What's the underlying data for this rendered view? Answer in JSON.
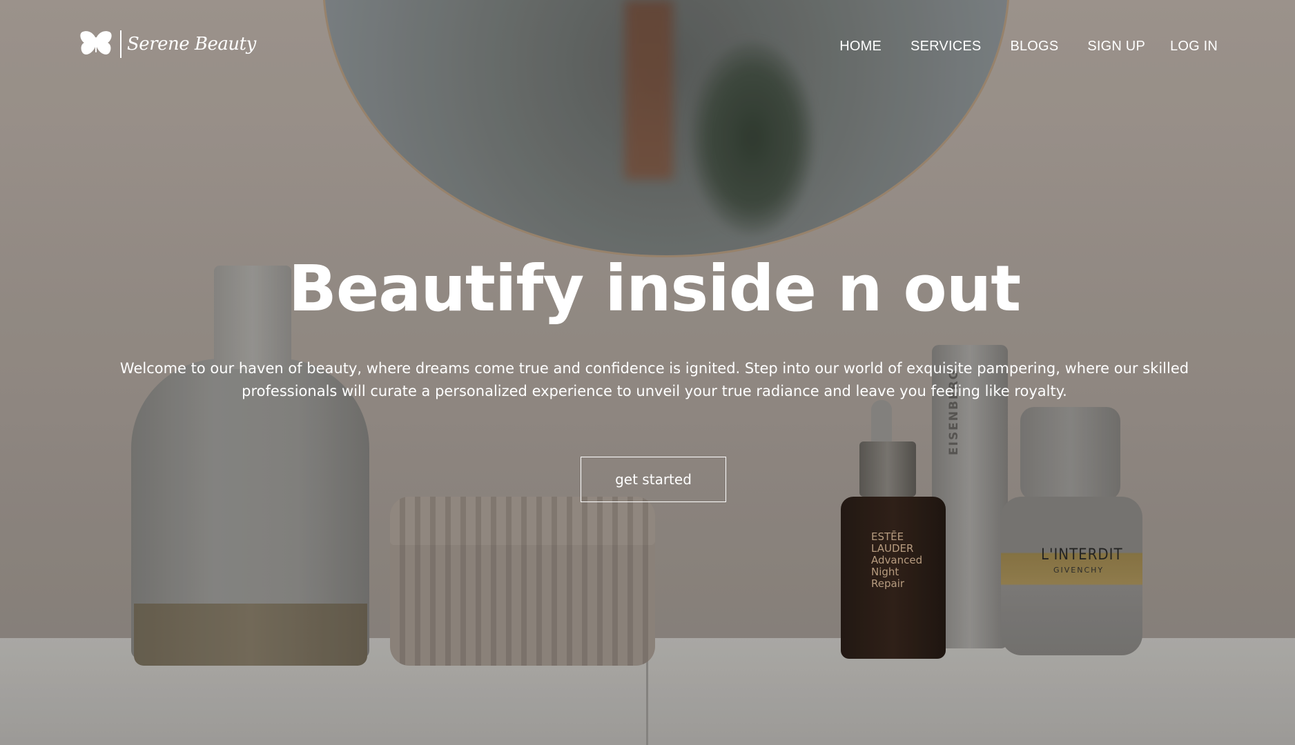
{
  "brand": {
    "name": "Serene Beauty",
    "logo_icon": "butterfly-icon"
  },
  "nav": {
    "items": [
      {
        "label": "HOME"
      },
      {
        "label": "SERVICES"
      },
      {
        "label": "BLOGS"
      },
      {
        "label": "SIGN UP"
      },
      {
        "label": "LOG IN"
      }
    ]
  },
  "hero": {
    "title": "Beautify inside n out",
    "description": "Welcome to our haven of beauty, where dreams come true and confidence is ignited. Step into our world of exquisite pampering, where our skilled professionals will curate a personalized experience to unveil your true radiance and leave you feeling like royalty.",
    "cta_label": "get started"
  },
  "background_labels": {
    "serum_brand": "ESTĒE LAUDER",
    "serum_name": "Advanced Night Repair",
    "tube_brand": "EISENBERG",
    "perfume_name": "L'INTERDIT",
    "perfume_brand": "GIVENCHY"
  },
  "colors": {
    "text": "#ffffff",
    "overlay": "#5a5550"
  }
}
